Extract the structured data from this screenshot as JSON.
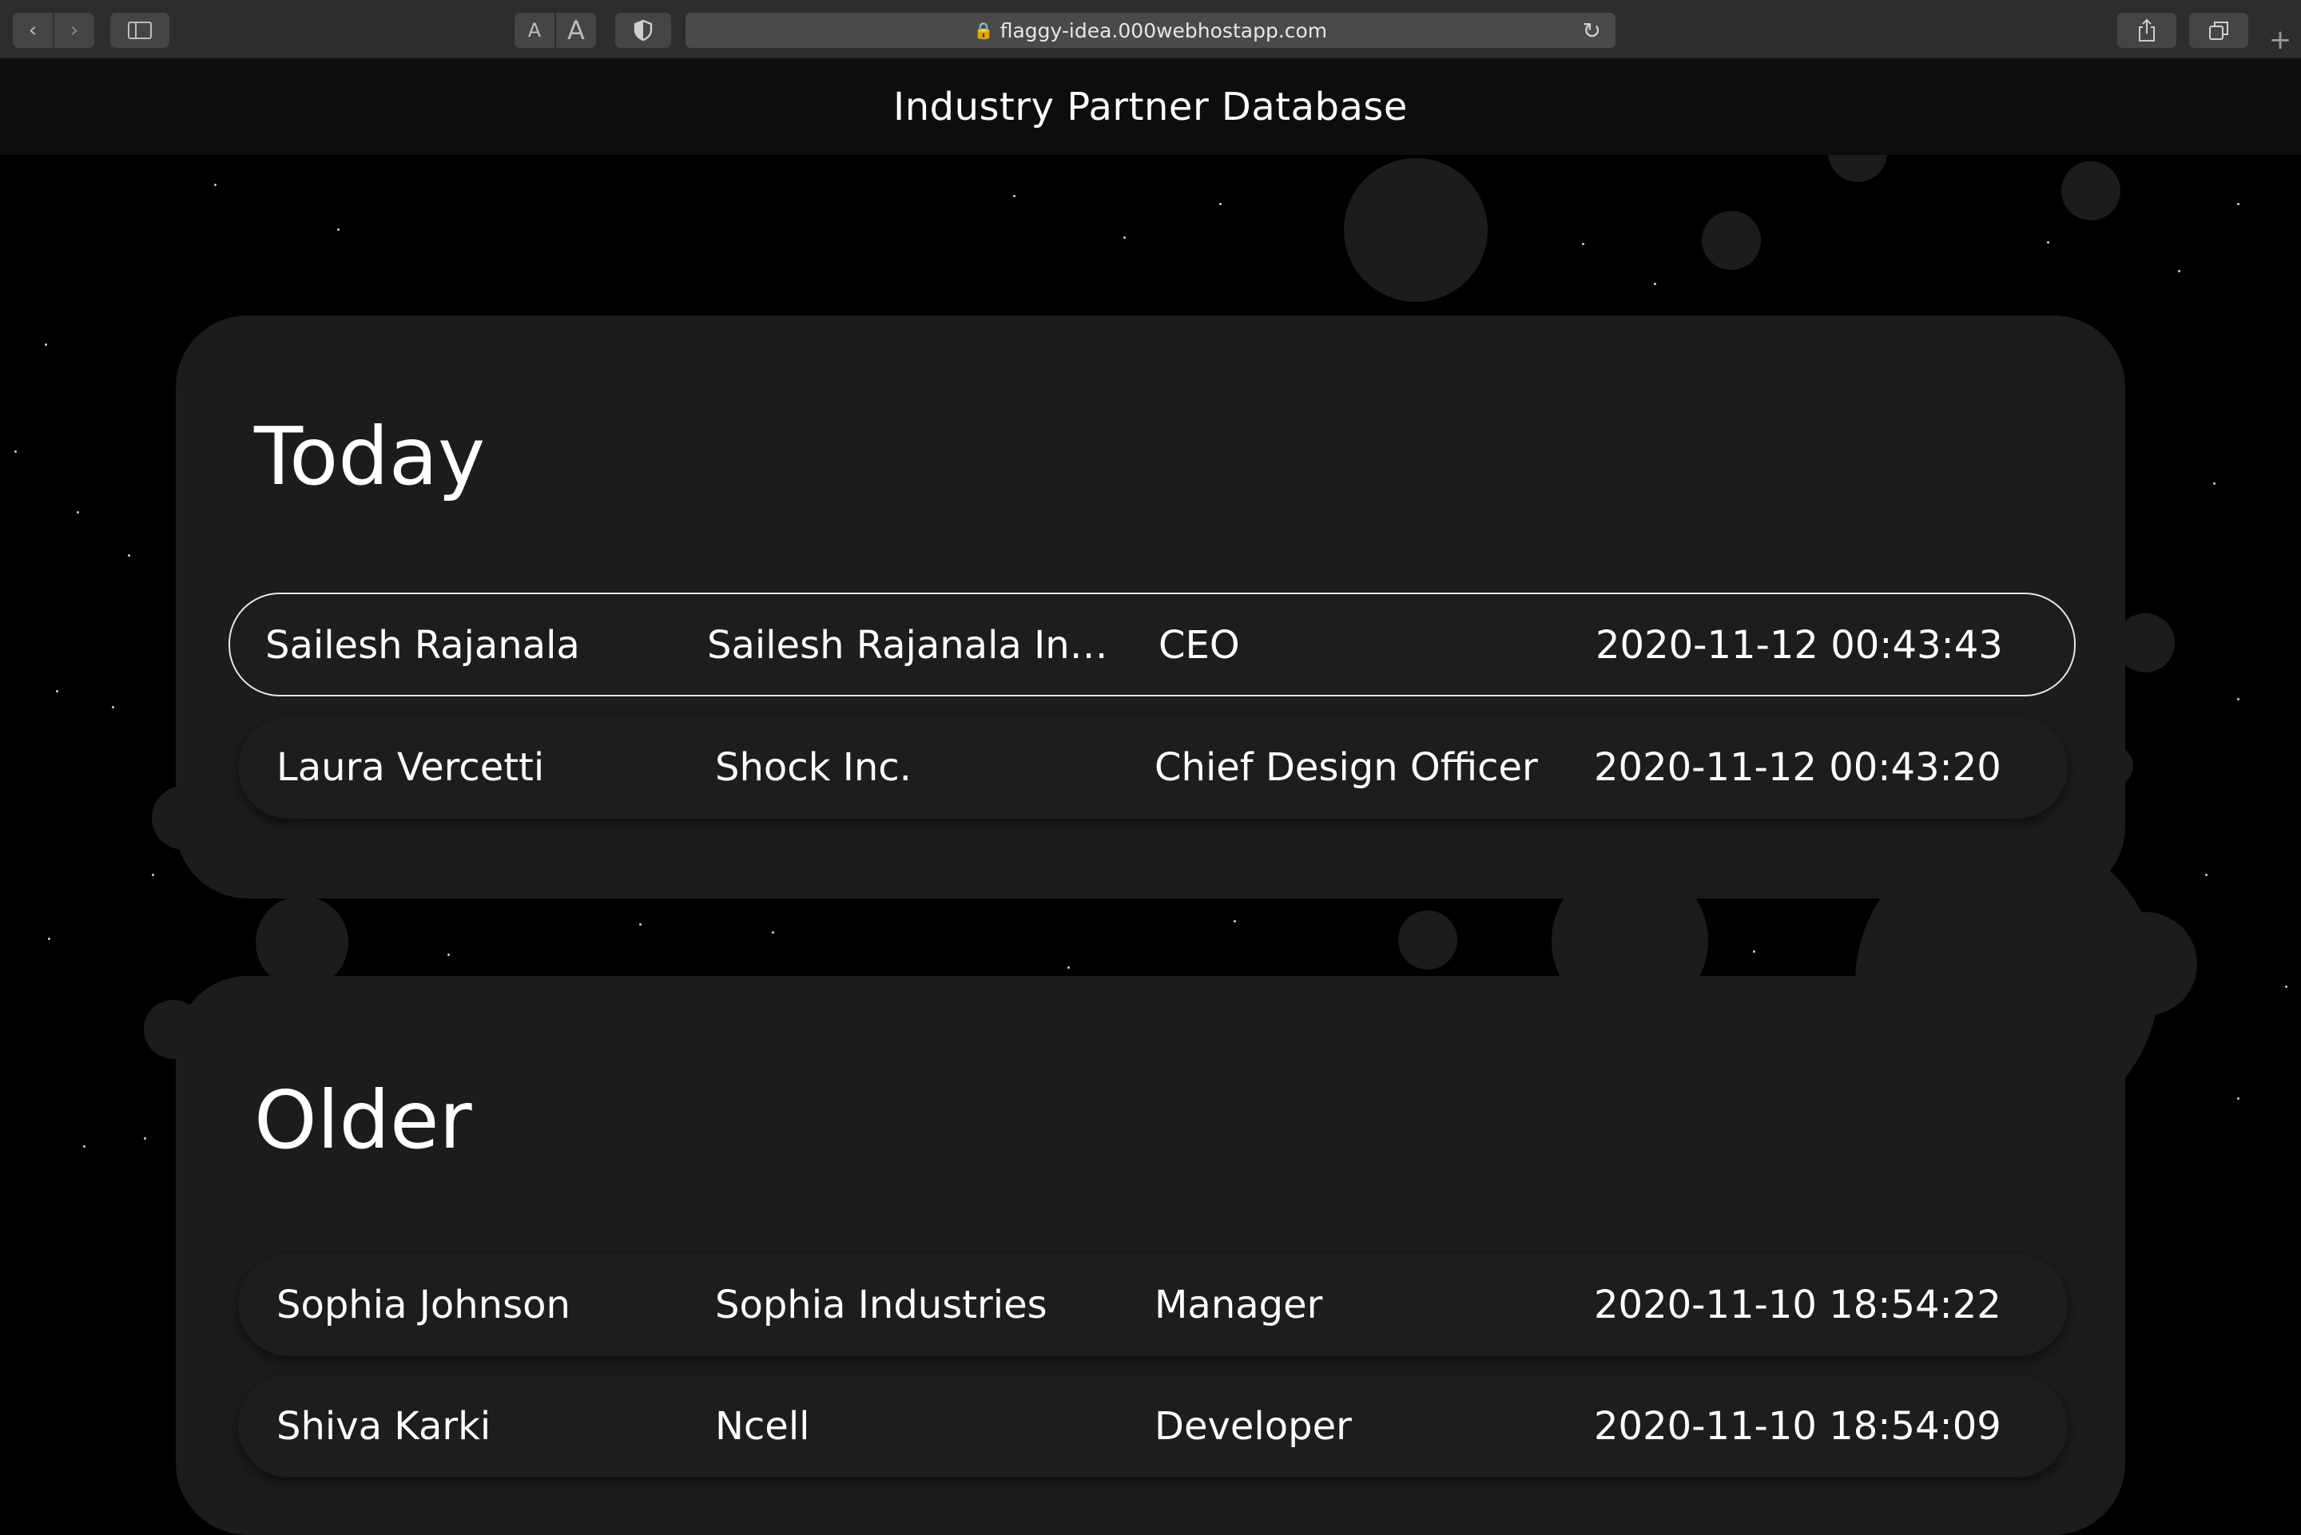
{
  "browser": {
    "back_icon": "‹",
    "forward_icon": "›",
    "font_small": "A",
    "font_large": "A",
    "url": "flaggy-idea.000webhostapp.com"
  },
  "header": {
    "title": "Industry Partner Database"
  },
  "sections": {
    "today": {
      "title": "Today",
      "rows": [
        {
          "name": "Sailesh Rajanala",
          "company": "Sailesh Rajanala Industries",
          "position": "CEO",
          "date": "2020-11-12 00:43:43"
        },
        {
          "name": "Laura Vercetti",
          "company": "Shock Inc.",
          "position": "Chief Design Officer",
          "date": "2020-11-12 00:43:20"
        }
      ]
    },
    "older": {
      "title": "Older",
      "rows": [
        {
          "name": "Sophia Johnson",
          "company": "Sophia Industries",
          "position": "Manager",
          "date": "2020-11-10 18:54:22"
        },
        {
          "name": "Shiva Karki",
          "company": "Ncell",
          "position": "Developer",
          "date": "2020-11-10 18:54:09"
        }
      ]
    }
  }
}
